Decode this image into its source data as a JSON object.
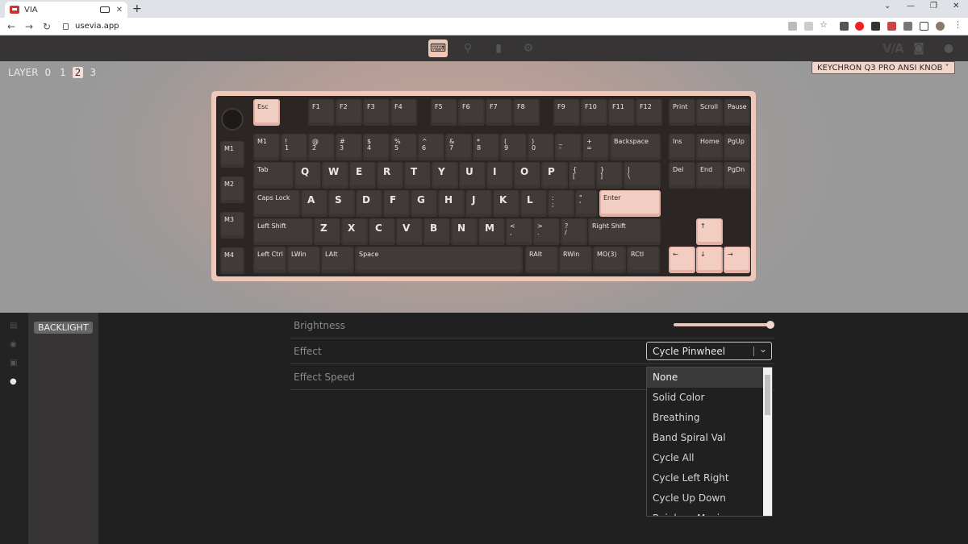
{
  "browser": {
    "tab_title": "VIA",
    "url": "usevia.app"
  },
  "layers": {
    "label": "LAYER",
    "items": [
      "0",
      "1",
      "2",
      "3"
    ],
    "active": "2"
  },
  "device": {
    "name": "KEYCHRON Q3 PRO ANSI KNOB ˅"
  },
  "keys": {
    "esc": "Esc",
    "f1": "F1",
    "f2": "F2",
    "f3": "F3",
    "f4": "F4",
    "f5": "F5",
    "f6": "F6",
    "f7": "F7",
    "f8": "F8",
    "f9": "F9",
    "f10": "F10",
    "f11": "F11",
    "f12": "F12",
    "print": "Print",
    "scroll": "Scroll",
    "pause": "Pause",
    "m1l": "M1",
    "m1": "M1",
    "k1": "!\n1",
    "k2": "@\n2",
    "k3": "#\n3",
    "k4": "$\n4",
    "k5": "%\n5",
    "k6": "^\n6",
    "k7": "&\n7",
    "k8": "*\n8",
    "k9": "(\n9",
    "k0": ")\n0",
    "minus": "_\n-",
    "equal": "+\n=",
    "backspace": "Backspace",
    "ins": "Ins",
    "home": "Home",
    "pgup": "PgUp",
    "m2l": "M2",
    "tab": "Tab",
    "q": "Q",
    "w": "W",
    "e": "E",
    "r": "R",
    "t": "T",
    "y": "Y",
    "u": "U",
    "i": "I",
    "o": "O",
    "p": "P",
    "lbr": "{\n[",
    "rbr": "}\n]",
    "bsl": "|\n\\",
    "del": "Del",
    "end": "End",
    "pgdn": "PgDn",
    "caps": "Caps Lock",
    "a": "A",
    "s": "S",
    "d": "D",
    "f": "F",
    "g": "G",
    "h": "H",
    "j": "J",
    "k": "K",
    "l": "L",
    "semi": ":\n;",
    "quote": "\"\n'",
    "enter": "Enter",
    "m3l": "M3",
    "lshift": "Left Shift",
    "z": "Z",
    "x": "X",
    "c": "C",
    "v": "V",
    "b": "B",
    "n": "N",
    "m": "M",
    "comma": "<\n,",
    "period": ">\n.",
    "slash": "?\n/",
    "rshift": "Right Shift",
    "up": "↑",
    "m4l": "M4",
    "lctrl": "Left Ctrl",
    "lwin": "LWin",
    "lalt": "LAlt",
    "space": "Space",
    "ralt": "RAlt",
    "rwin": "RWin",
    "mo3": "MO(3)",
    "rctl": "RCtl",
    "left": "←",
    "down": "↓",
    "right": "→"
  },
  "menu": {
    "backlight": "BACKLIGHT"
  },
  "settings": {
    "brightness_label": "Brightness",
    "brightness_value": 1.0,
    "effect_label": "Effect",
    "effect_value": "Cycle Pinwheel",
    "speed_label": "Effect Speed"
  },
  "dropdown": {
    "options": [
      "None",
      "Solid Color",
      "Breathing",
      "Band Spiral Val",
      "Cycle All",
      "Cycle Left Right",
      "Cycle Up Down",
      "Rainbow Moving Chevron"
    ]
  },
  "icons": {
    "keyboard": "keyboard-icon",
    "configure": "configure-icon",
    "design": "design-icon",
    "settings": "gear-icon"
  }
}
